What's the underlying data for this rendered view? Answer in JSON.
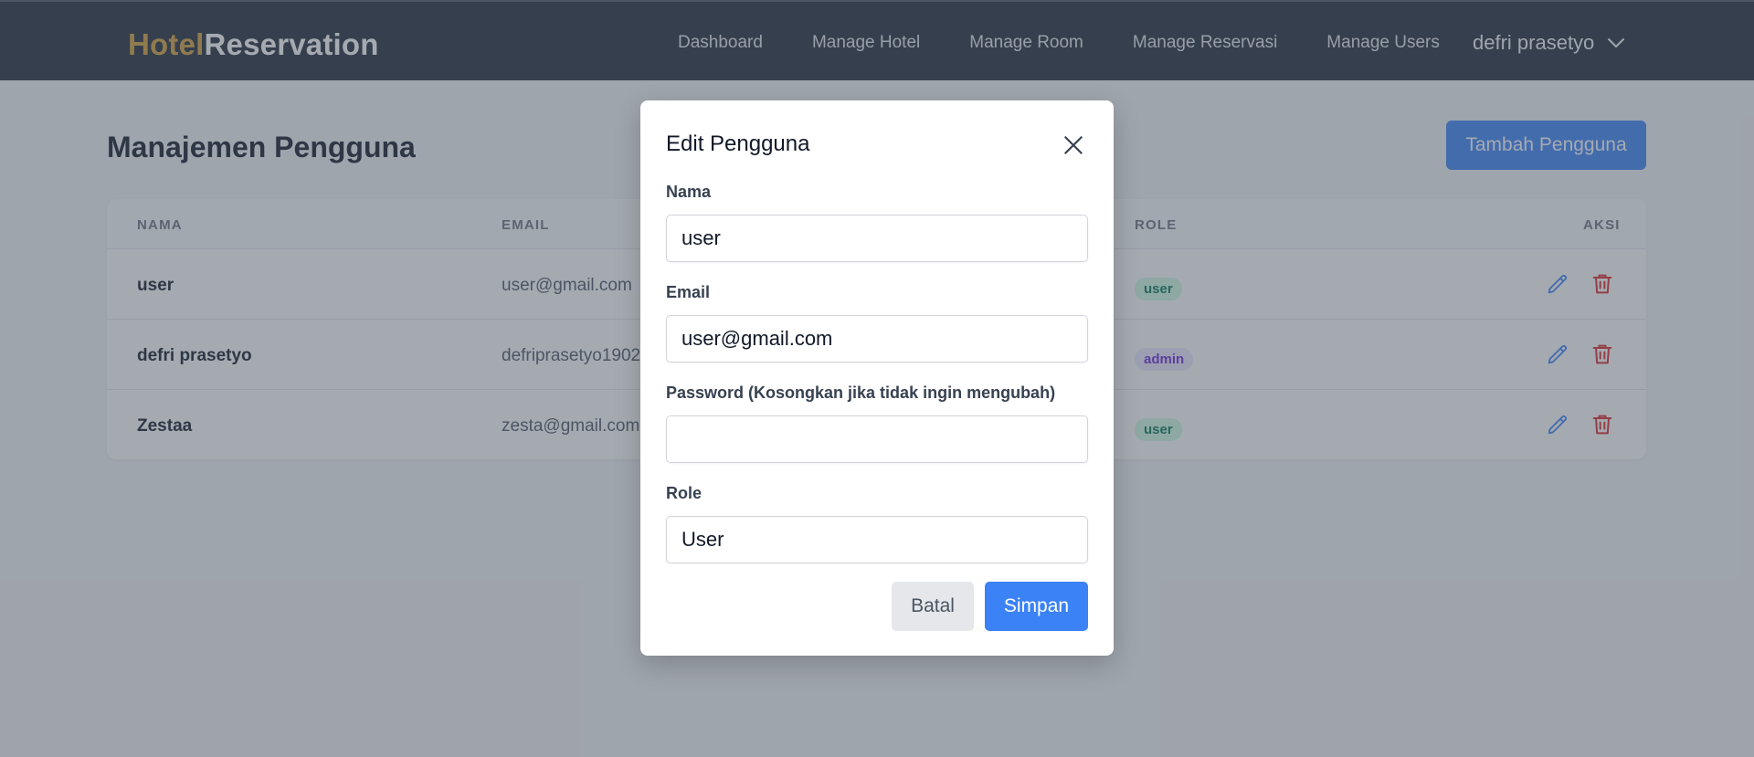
{
  "navbar": {
    "brand_part1": "Hotel",
    "brand_part2": "Reservation",
    "links": [
      "Dashboard",
      "Manage Hotel",
      "Manage Room",
      "Manage Reservasi",
      "Manage Users"
    ],
    "user_name": "defri prasetyo",
    "user_icon": "chevron-down-icon"
  },
  "page": {
    "title": "Manajemen Pengguna",
    "add_button": "Tambah Pengguna"
  },
  "table": {
    "headers": {
      "nama": "NAMA",
      "email": "EMAIL",
      "role": "ROLE",
      "aksi": "AKSI"
    },
    "rows": [
      {
        "name": "user",
        "email": "user@gmail.com",
        "role": "user"
      },
      {
        "name": "defri prasetyo",
        "email": "defriprasetyo1902",
        "role": "admin"
      },
      {
        "name": "Zestaa",
        "email": "zesta@gmail.com",
        "role": "user"
      }
    ],
    "action_icons": [
      "edit-icon",
      "trash-icon"
    ]
  },
  "modal": {
    "title": "Edit Pengguna",
    "name_label": "Nama",
    "name_value": "user",
    "email_label": "Email",
    "email_value": "user@gmail.com",
    "password_label": "Password (Kosongkan jika tidak ingin mengubah)",
    "password_value": "",
    "role_label": "Role",
    "role_value": "User",
    "cancel_button": "Batal",
    "save_button": "Simpan"
  },
  "colors": {
    "navbar_bg": "#1f2937",
    "brand_accent": "#d4a13a",
    "primary": "#3b82f6",
    "edit_icon": "#3b82f6",
    "delete_icon": "#dc2626",
    "badge_user_bg": "#d1fae5",
    "badge_admin_bg": "#ede9fe"
  }
}
